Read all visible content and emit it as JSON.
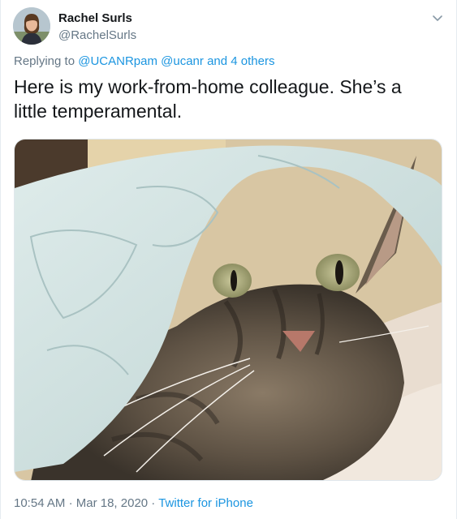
{
  "user": {
    "name": "Rachel Surls",
    "handle": "@RachelSurls"
  },
  "reply": {
    "prefix": "Replying to",
    "mention_1": "@UCANRpam",
    "mention_2": "@ucanr",
    "separator": "and",
    "others": "4 others"
  },
  "tweet": {
    "text": "Here is my work-from-home colleague. She’s a little temperamental."
  },
  "media": {
    "description": "photo of a tabby cat peeking out from under a light blue quilted blanket"
  },
  "meta": {
    "time": "10:54 AM",
    "dot_1": "·",
    "date": "Mar 18, 2020",
    "dot_2": "·",
    "source": "Twitter for iPhone"
  },
  "icons": {
    "caret": "chevron-down-icon"
  },
  "colors": {
    "link": "#1b95e0",
    "secondary_text": "#657786",
    "primary_text": "#14171a"
  }
}
